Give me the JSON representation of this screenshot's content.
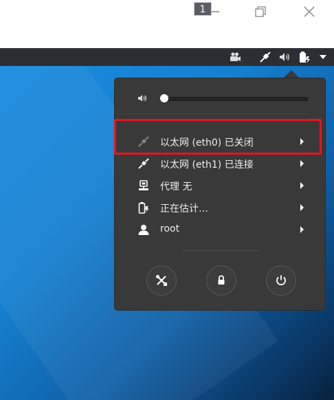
{
  "workspace": {
    "number": "1"
  },
  "volume": {
    "level": 0.0
  },
  "menu_items": [
    {
      "label": "以太网 (eth0) 已关闭",
      "icon": "ethernet-disconnected-icon"
    },
    {
      "label": "以太网 (eth1) 已连接",
      "icon": "ethernet-connected-icon"
    },
    {
      "label": "代理 无",
      "icon": "proxy-icon"
    },
    {
      "label": "正在估计…",
      "icon": "battery-charging-icon"
    },
    {
      "label": "root",
      "icon": "user-icon"
    }
  ],
  "actions": [
    {
      "icon": "settings-tools-icon"
    },
    {
      "icon": "lock-icon"
    },
    {
      "icon": "power-icon"
    }
  ],
  "colors": {
    "highlight": "#e8141c",
    "menu_bg": "#393939",
    "panel_bg": "#2b2f33"
  }
}
